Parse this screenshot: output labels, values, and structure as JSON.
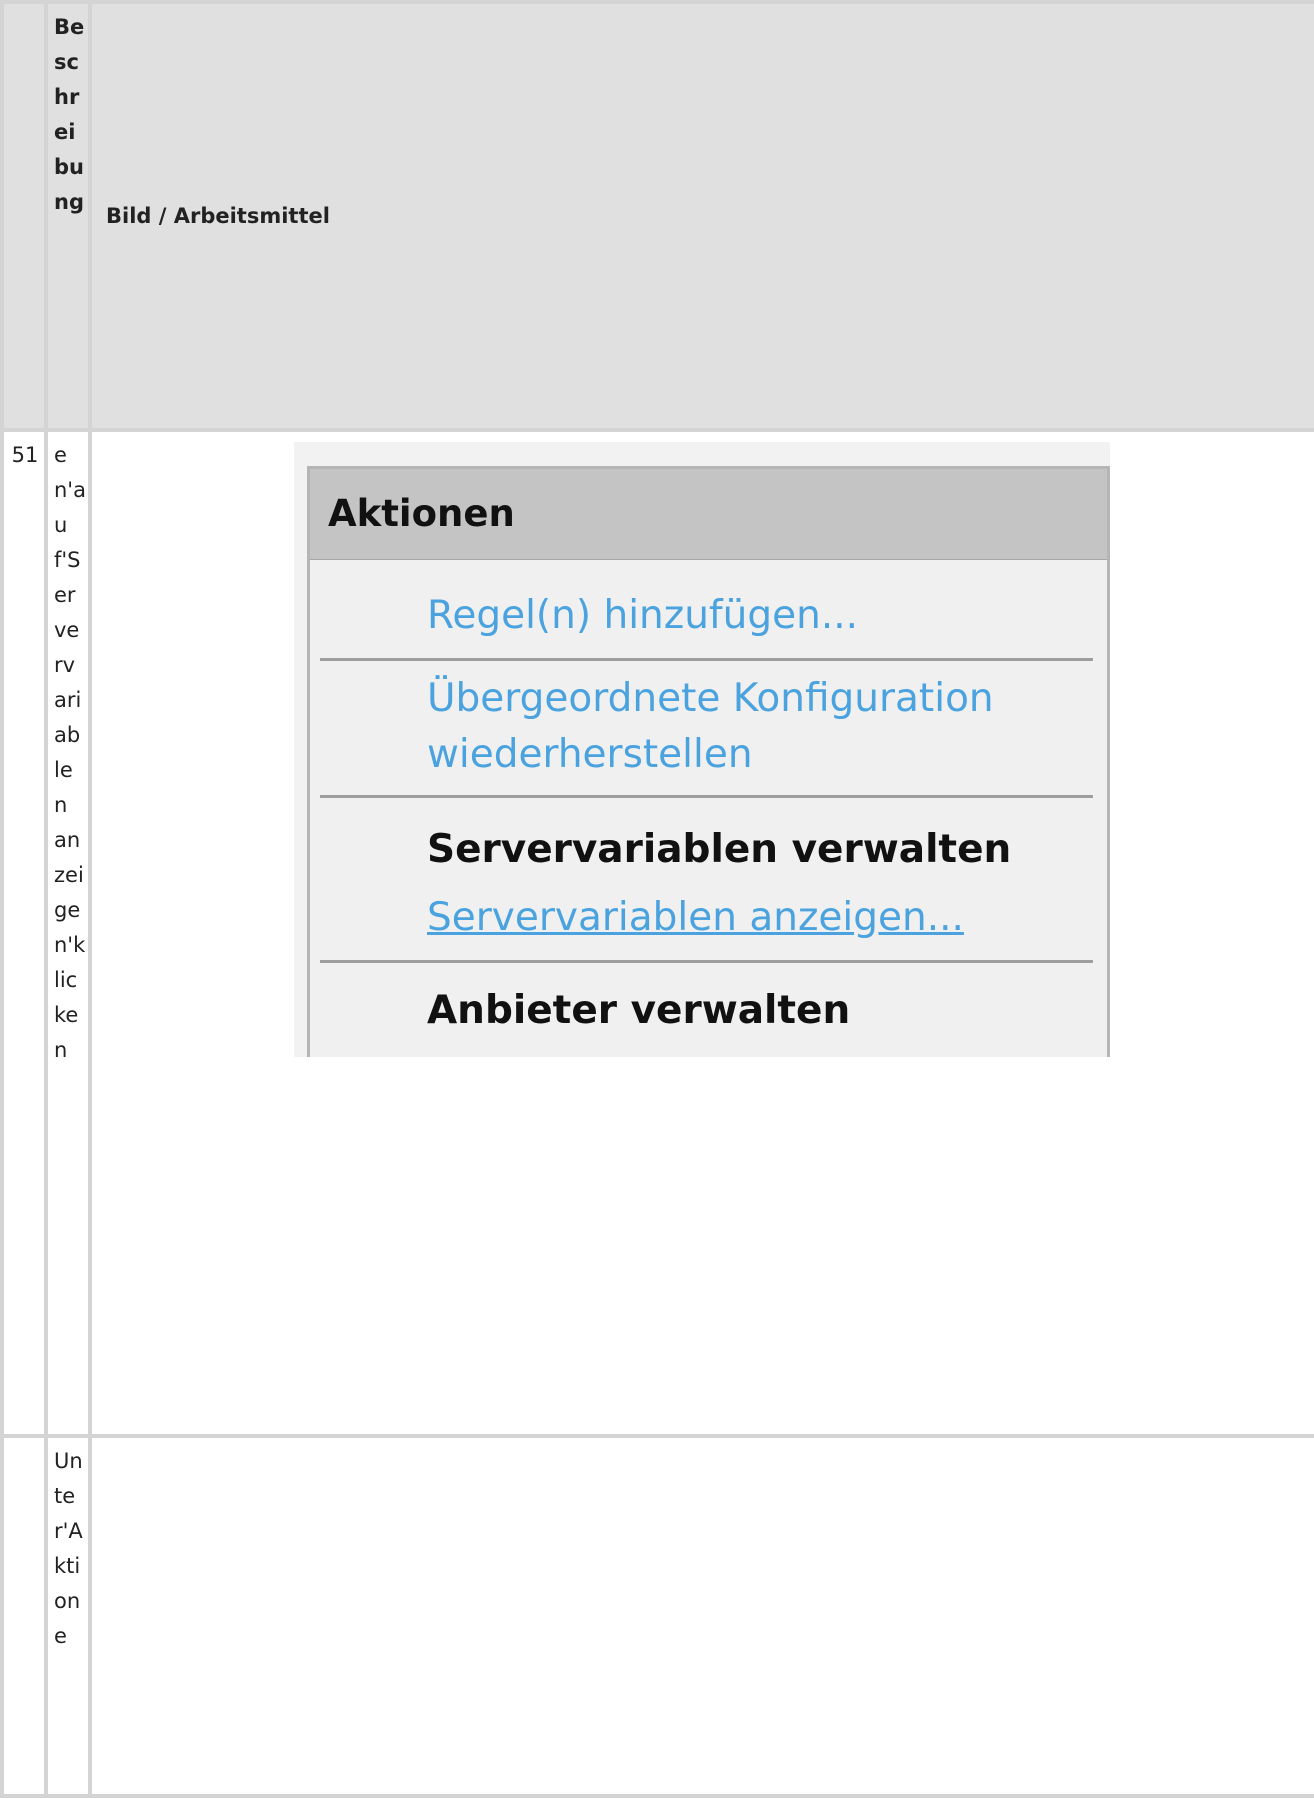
{
  "table": {
    "headers": {
      "number": "",
      "description": "Beschreibung",
      "image": "Bild / Arbeitsmittel"
    },
    "rows": [
      {
        "number": "51",
        "description": "en'auf'Servervariablen anzeigen'klicken"
      },
      {
        "number": "",
        "description": "Unter'Aktione"
      }
    ]
  },
  "screenshot": {
    "panel_title": "Aktionen",
    "actions": {
      "add_rules": "Regel(n) hinzufügen...",
      "restore_parent": "Übergeordnete Konfiguration wiederherstellen",
      "manage_server_vars_title": "Servervariablen verwalten",
      "show_server_vars": "Servervariablen anzeigen...",
      "manage_providers_title": "Anbieter verwalten"
    },
    "colors": {
      "link": "#4aa3df",
      "header_bg": "#c4c4c4",
      "panel_bg": "#f0f0f0"
    }
  }
}
